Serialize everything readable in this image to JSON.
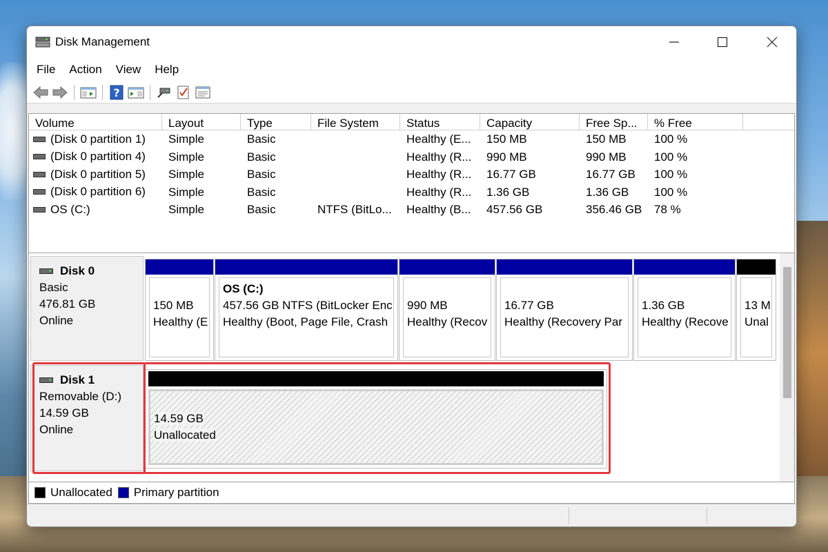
{
  "window": {
    "title": "Disk Management"
  },
  "menu": [
    "File",
    "Action",
    "View",
    "Help"
  ],
  "volume_table": {
    "columns": [
      "Volume",
      "Layout",
      "Type",
      "File System",
      "Status",
      "Capacity",
      "Free Sp...",
      "% Free"
    ],
    "rows": [
      [
        "(Disk 0 partition 1)",
        "Simple",
        "Basic",
        "",
        "Healthy (E...",
        "150 MB",
        "150 MB",
        "100 %"
      ],
      [
        "(Disk 0 partition 4)",
        "Simple",
        "Basic",
        "",
        "Healthy (R...",
        "990 MB",
        "990 MB",
        "100 %"
      ],
      [
        "(Disk 0 partition 5)",
        "Simple",
        "Basic",
        "",
        "Healthy (R...",
        "16.77 GB",
        "16.77 GB",
        "100 %"
      ],
      [
        "(Disk 0 partition 6)",
        "Simple",
        "Basic",
        "",
        "Healthy (R...",
        "1.36 GB",
        "1.36 GB",
        "100 %"
      ],
      [
        "OS (C:)",
        "Simple",
        "Basic",
        "NTFS (BitLo...",
        "Healthy (B...",
        "457.56 GB",
        "356.46 GB",
        "78 %"
      ]
    ]
  },
  "disks": [
    {
      "name": "Disk 0",
      "type": "Basic",
      "size": "476.81 GB",
      "state": "Online",
      "partitions": [
        {
          "name": "",
          "line1": "150 MB",
          "line2": "Healthy (E"
        },
        {
          "name": "OS  (C:)",
          "line1": "457.56 GB NTFS (BitLocker Enc",
          "line2": "Healthy (Boot, Page File, Crash"
        },
        {
          "name": "",
          "line1": "990 MB",
          "line2": "Healthy (Recov"
        },
        {
          "name": "",
          "line1": "16.77 GB",
          "line2": "Healthy (Recovery Par"
        },
        {
          "name": "",
          "line1": "1.36 GB",
          "line2": "Healthy (Recove"
        },
        {
          "name": "",
          "line1": "13 M",
          "line2": "Unal"
        }
      ]
    },
    {
      "name": "Disk 1",
      "type": "Removable (D:)",
      "size": "14.59 GB",
      "state": "Online",
      "partitions": [
        {
          "name": "",
          "line1": "14.59 GB",
          "line2": "Unallocated"
        }
      ]
    }
  ],
  "legend": [
    {
      "label": "Unallocated",
      "color": "#000000"
    },
    {
      "label": "Primary partition",
      "color": "#0000a0"
    }
  ],
  "colors": {
    "primary_partition": "#0000a0",
    "unallocated": "#000000",
    "highlight": "#e0393e"
  }
}
